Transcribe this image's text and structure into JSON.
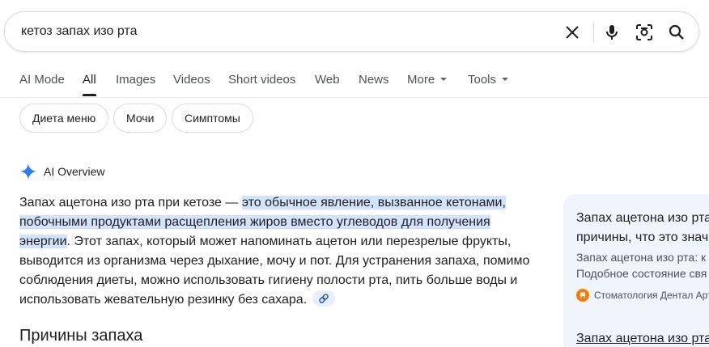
{
  "search": {
    "query": "кетоз запах изо рта"
  },
  "tabs": [
    {
      "label": "AI Mode"
    },
    {
      "label": "All"
    },
    {
      "label": "Images"
    },
    {
      "label": "Videos"
    },
    {
      "label": "Short videos"
    },
    {
      "label": "Web"
    },
    {
      "label": "News"
    },
    {
      "label": "More"
    },
    {
      "label": "Tools"
    }
  ],
  "chips": [
    {
      "label": "Диета меню"
    },
    {
      "label": "Мочи"
    },
    {
      "label": "Симптомы"
    }
  ],
  "ai_overview": {
    "label": "AI Overview",
    "text_before": "Запах ацетона изо рта при кетозе — ",
    "text_highlight": "это обычное явление, вызванное кетонами, побочными продуктами расщепления жиров вместо углеводов для получения энергии",
    "text_after": ". Этот запах, который может напоминать ацетон или перезрелые фрукты, выводится из организма через дыхание, мочу и пот. Для устранения запаха, помимо соблюдения диеты, можно использовать гигиену полости рта, пить больше воды и использовать жевательную резинку без сахара.",
    "section_title": "Причины запаха"
  },
  "card": {
    "title_line1": "Запах ацетона изо рта",
    "title_line2": "причины, что это знач",
    "snippet_line1": "Запах ацетона изо рта: к",
    "snippet_line2": "Подобное состояние свя",
    "source": "Стоматология Дентал Арт",
    "link2": "Запах ацетона изо рта"
  },
  "colors": {
    "highlight": "#d3e3fd",
    "card_bg": "#f0f4fb",
    "source_icon": "#f57c00"
  }
}
